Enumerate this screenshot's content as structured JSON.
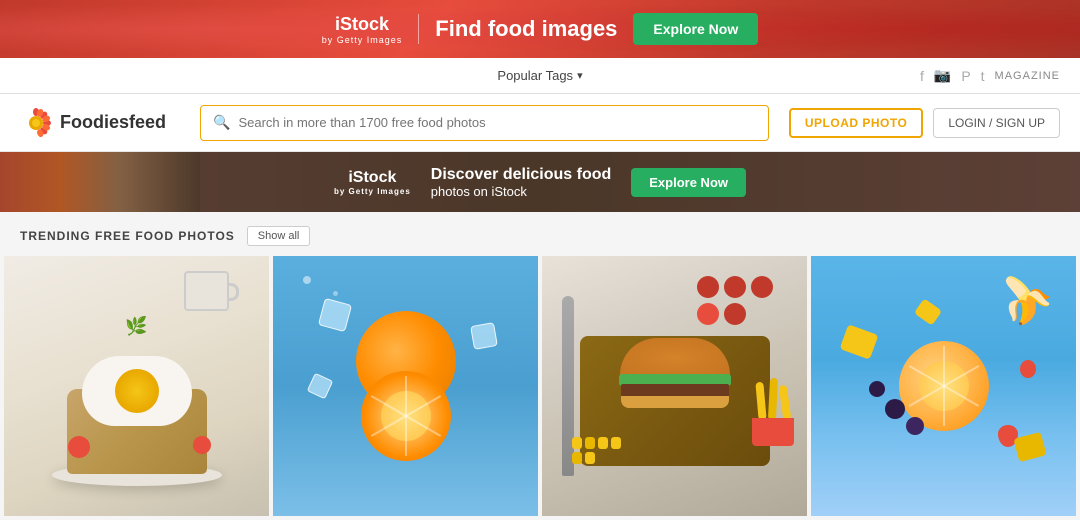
{
  "topBanner": {
    "brand": "iStock",
    "brandSub": "by Getty Images",
    "headline": "Find food images",
    "ctaLabel": "Explore Now"
  },
  "navBar": {
    "popularTagsLabel": "Popular Tags",
    "magazineLabel": "MAGAZINE"
  },
  "header": {
    "logoText": "Foodiesfeed",
    "searchPlaceholder": "Search in more than 1700 free food photos",
    "uploadLabel": "UPLOAD PHOTO",
    "loginLabel": "LOGIN / SIGN UP"
  },
  "secondaryBanner": {
    "brand": "iStock",
    "brandSub": "by Getty Images",
    "line1": "Discover delicious food",
    "line2": "photos on iStock",
    "ctaLabel": "Explore Now"
  },
  "trending": {
    "title": "TRENDING FREE FOOD PHOTOS",
    "showAllLabel": "Show all"
  },
  "photos": [
    {
      "id": "photo-1",
      "alt": "Egg toast with tomatoes and herbs"
    },
    {
      "id": "photo-2",
      "alt": "Orange slices with ice on blue background"
    },
    {
      "id": "photo-3",
      "alt": "Burger with fries and vegetables"
    },
    {
      "id": "photo-4",
      "alt": "Fruit scatter on blue background"
    }
  ]
}
